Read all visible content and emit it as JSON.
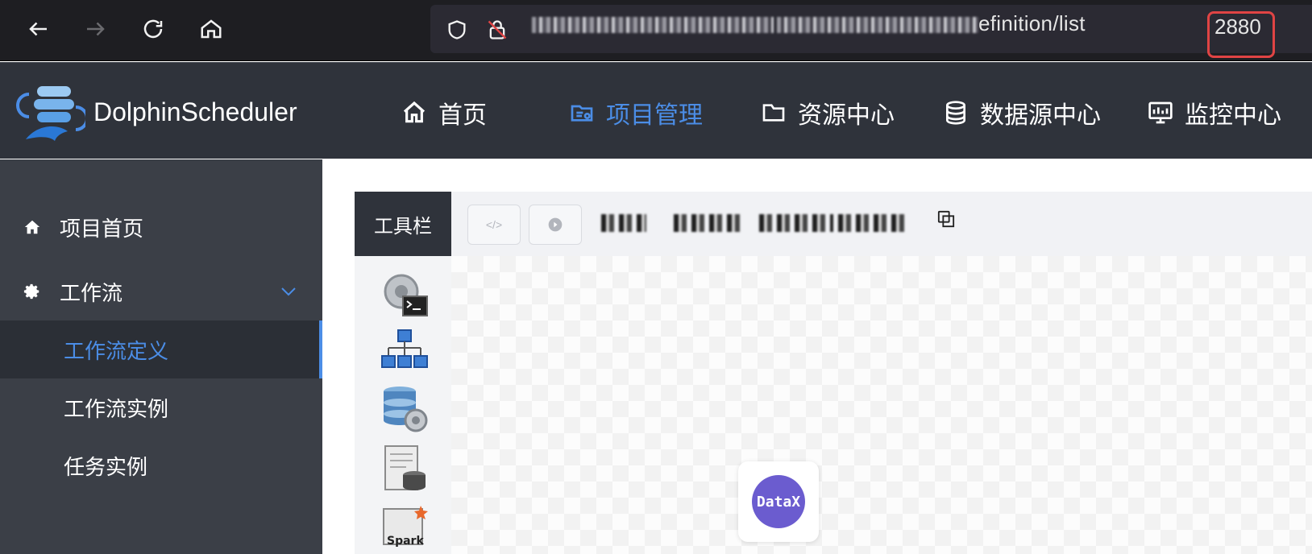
{
  "browser": {
    "url_visible_suffix": "efinition/list",
    "url_highlighted": "2880",
    "highlight_color": "#e04444"
  },
  "app": {
    "brand": "DolphinScheduler",
    "accent_color": "#4b8de6",
    "nav": [
      {
        "label": "首页",
        "icon": "home-icon"
      },
      {
        "label": "项目管理",
        "icon": "project-icon",
        "active": true
      },
      {
        "label": "资源中心",
        "icon": "folder-icon"
      },
      {
        "label": "数据源中心",
        "icon": "database-icon"
      },
      {
        "label": "监控中心",
        "icon": "monitor-icon"
      }
    ]
  },
  "sidebar": {
    "items": [
      {
        "label": "项目首页",
        "icon": "home-icon"
      },
      {
        "label": "工作流",
        "icon": "gear-icon",
        "expanded": true
      }
    ],
    "sub_items": [
      {
        "label": "工作流定义",
        "active": true
      },
      {
        "label": "工作流实例"
      },
      {
        "label": "任务实例"
      }
    ]
  },
  "editor": {
    "toolbar_label": "工具栏",
    "canvas_node_label": "DataX",
    "palette_icons": [
      "shell-task-icon",
      "sub-process-icon",
      "procedure-icon",
      "sql-icon",
      "spark-icon"
    ]
  }
}
